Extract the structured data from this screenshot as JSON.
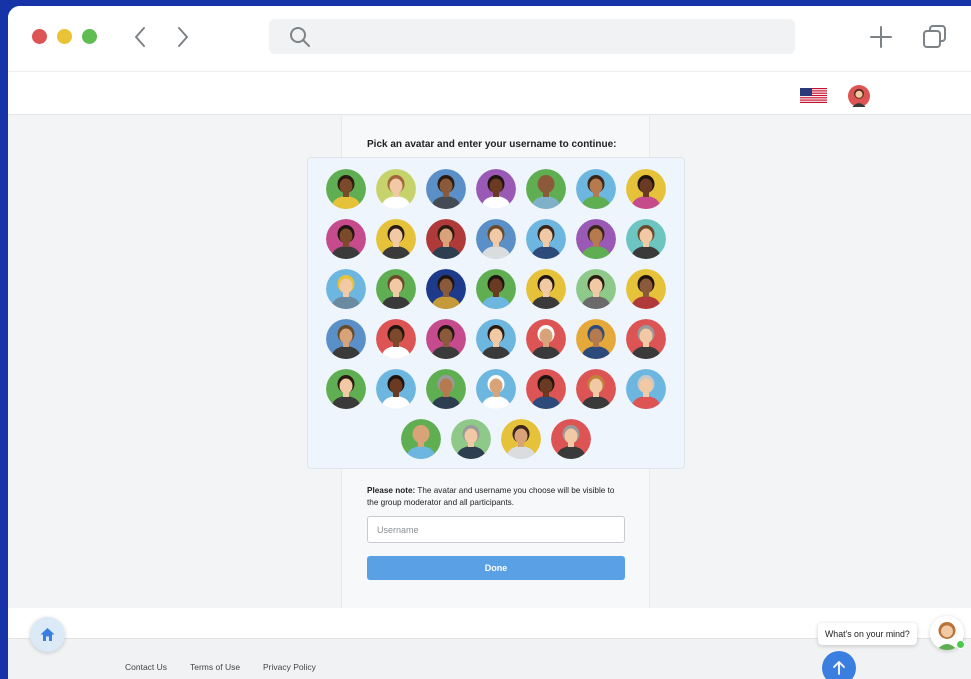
{
  "browser": {
    "window_controls": [
      {
        "name": "close",
        "color": "#dc5453"
      },
      {
        "name": "minimize",
        "color": "#e9c333"
      },
      {
        "name": "maximize",
        "color": "#5fbd54"
      }
    ],
    "icons": [
      "chevron-left-icon",
      "chevron-right-icon",
      "search-icon",
      "plus-icon",
      "copy-tabs-icon"
    ]
  },
  "header": {
    "language_flag": "us-flag-icon",
    "user_avatar": "user-avatar-icon"
  },
  "page": {
    "prompt": "Pick an avatar and enter your username to continue:",
    "note_bold": "Please note:",
    "note_text": " The avatar and username you choose will be visible to the group moderator and all participants.",
    "username_placeholder": "Username",
    "username_value": "",
    "done_label": "Done",
    "accent_color": "#5aa0e4"
  },
  "avatars": {
    "rows": [
      [
        {
          "bg": "#5fae52",
          "skin": "#7a4a2a",
          "hair": "#2a1a10",
          "shirt": "#e5c23a"
        },
        {
          "bg": "#c6d36a",
          "skin": "#f1c9a5",
          "hair": "#a0683a",
          "shirt": "#ffffff"
        },
        {
          "bg": "#5b8fc7",
          "skin": "#8a5a3a",
          "hair": "#2a1a10",
          "shirt": "#444b55"
        },
        {
          "bg": "#9b59b6",
          "skin": "#6a3a22",
          "hair": "#1f1410",
          "shirt": "#ffffff"
        },
        {
          "bg": "#5fae52",
          "skin": "#8a5a3a",
          "hair": "#8a5a3a",
          "shirt": "#7fb2c9"
        },
        {
          "bg": "#6cb6e0",
          "skin": "#b57a4e",
          "hair": "#3a2418",
          "shirt": "#5fae52"
        },
        {
          "bg": "#e5c23a",
          "skin": "#6a3a22",
          "hair": "#1f1410",
          "shirt": "#c54b8c"
        }
      ],
      [
        {
          "bg": "#c54b8c",
          "skin": "#7a4a2a",
          "hair": "#1f1410",
          "shirt": "#3a3a3a"
        },
        {
          "bg": "#e5c23a",
          "skin": "#f1c9a5",
          "hair": "#2a1a10",
          "shirt": "#3a3a3a"
        },
        {
          "bg": "#b03a3a",
          "skin": "#d9a37a",
          "hair": "#2a1a10",
          "shirt": "#2c3e50"
        },
        {
          "bg": "#5b8fc7",
          "skin": "#f1c9a5",
          "hair": "#6a4a2a",
          "shirt": "#d9dde0"
        },
        {
          "bg": "#6cb6e0",
          "skin": "#f1c9a5",
          "hair": "#3a2418",
          "shirt": "#2c4a7a"
        },
        {
          "bg": "#9b59b6",
          "skin": "#b57a4e",
          "hair": "#3a2418",
          "shirt": "#5fae52"
        },
        {
          "bg": "#6cc5c0",
          "skin": "#f1c9a5",
          "hair": "#6a4a2a",
          "shirt": "#3a3a3a"
        }
      ],
      [
        {
          "bg": "#6cb6e0",
          "skin": "#f1c9a5",
          "hair": "#e5c23a",
          "shirt": "#6a8aa0"
        },
        {
          "bg": "#5fae52",
          "skin": "#f1c9a5",
          "hair": "#6a4a2a",
          "shirt": "#3a3a3a"
        },
        {
          "bg": "#1e3a8a",
          "skin": "#8a5a3a",
          "hair": "#1f1410",
          "shirt": "#c59a3a"
        },
        {
          "bg": "#5fae52",
          "skin": "#6a3a22",
          "hair": "#1f1410",
          "shirt": "#6cb6e0"
        },
        {
          "bg": "#e5c23a",
          "skin": "#f1c9a5",
          "hair": "#1f1410",
          "shirt": "#3a3a3a"
        },
        {
          "bg": "#8fc98a",
          "skin": "#f1c9a5",
          "hair": "#2a1a10",
          "shirt": "#6a6a6a"
        },
        {
          "bg": "#e5c23a",
          "skin": "#8a5a3a",
          "hair": "#1f1410",
          "shirt": "#b03a3a"
        }
      ],
      [
        {
          "bg": "#5b8fc7",
          "skin": "#d9a37a",
          "hair": "#6a4a2a",
          "shirt": "#3a3a3a"
        },
        {
          "bg": "#dc5453",
          "skin": "#7a4a2a",
          "hair": "#1f1410",
          "shirt": "#ffffff"
        },
        {
          "bg": "#c54b8c",
          "skin": "#8a5a3a",
          "hair": "#1f1410",
          "shirt": "#3a3a3a"
        },
        {
          "bg": "#6cb6e0",
          "skin": "#f1c9a5",
          "hair": "#2a1a10",
          "shirt": "#3a3a3a"
        },
        {
          "bg": "#dc5453",
          "skin": "#d9a37a",
          "hair": "#ffffff",
          "shirt": "#3a3a3a"
        },
        {
          "bg": "#e5a83a",
          "skin": "#b57a4e",
          "hair": "#2c4a7a",
          "shirt": "#2c4a7a"
        },
        {
          "bg": "#dc5453",
          "skin": "#f1c9a5",
          "hair": "#9a9a9a",
          "shirt": "#3a3a3a"
        }
      ],
      [
        {
          "bg": "#5fae52",
          "skin": "#f1c9a5",
          "hair": "#2a1a10",
          "shirt": "#3a3a3a"
        },
        {
          "bg": "#6cb6e0",
          "skin": "#6a3a22",
          "hair": "#1f1410",
          "shirt": "#ffffff"
        },
        {
          "bg": "#5fae52",
          "skin": "#b57a4e",
          "hair": "#9a9a9a",
          "shirt": "#2c3e50"
        },
        {
          "bg": "#6cb6e0",
          "skin": "#d9a37a",
          "hair": "#ffffff",
          "shirt": "#ffffff"
        },
        {
          "bg": "#dc5453",
          "skin": "#6a3a22",
          "hair": "#1f1410",
          "shirt": "#2c4a7a"
        },
        {
          "bg": "#dc5453",
          "skin": "#f1c9a5",
          "hair": "#c5803a",
          "shirt": "#3a3a3a"
        },
        {
          "bg": "#6cb6e0",
          "skin": "#f1c9a5",
          "hair": "#c8c8c8",
          "shirt": "#dc5453"
        }
      ],
      [
        {
          "bg": "#5fae52",
          "skin": "#d9a37a",
          "hair": "#d9a37a",
          "shirt": "#6cb6e0"
        },
        {
          "bg": "#8fc98a",
          "skin": "#f1c9a5",
          "hair": "#9a9a9a",
          "shirt": "#2c3e50"
        },
        {
          "bg": "#e5c23a",
          "skin": "#d9a37a",
          "hair": "#3a2418",
          "shirt": "#d9dde0"
        },
        {
          "bg": "#dc5453",
          "skin": "#f1c9a5",
          "hair": "#9a9a9a",
          "shirt": "#3a3a3a"
        }
      ]
    ]
  },
  "footer": {
    "links": [
      "Contact Us",
      "Terms of Use",
      "Privacy Policy"
    ]
  },
  "chat": {
    "prompt": "What's on your mind?",
    "online_color": "#4cc94c"
  }
}
